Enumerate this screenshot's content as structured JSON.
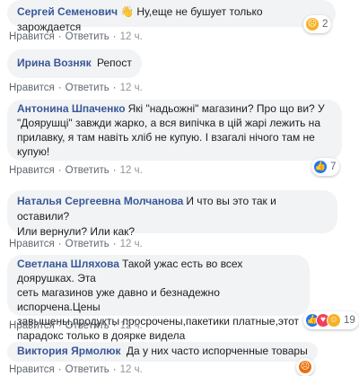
{
  "comments": [
    {
      "author": "Сергей Семенович",
      "emoji": "👋",
      "text": "Ну,еще не бушует только зарождается",
      "like_label": "Нравится",
      "reply_label": "Ответить",
      "time": "12 ч.",
      "reaction_icon": "sad-face-icon",
      "reaction_count": "2"
    },
    {
      "author": "Ирина Возняк",
      "text": "Репост",
      "like_label": "Нравится",
      "reply_label": "Ответить",
      "time": "12 ч."
    },
    {
      "author": "Антонина Шпаченко",
      "text_lines": [
        "Які \"надьожні\" магазини? Про що ви? У",
        "\"Доярушці\" завжди жарко, а вся випічка в цій жарі лежить на",
        "прилавку, я там навіть хліб не купую. І взагалі нічого там не",
        "купую!"
      ],
      "like_label": "Нравится",
      "reply_label": "Ответить",
      "time": "12 ч.",
      "reaction_icon": "like-icon",
      "reaction_count": "7"
    },
    {
      "author": "Наталья Сергеевна Молчанова",
      "text_first": "И что вы это так и оставили?",
      "text_second": "Или вернули? Или как?",
      "like_label": "Нравится",
      "reply_label": "Ответить",
      "time": "12 ч."
    },
    {
      "author": "Светлана Шляхова",
      "text_first": "Такой ужас есть во всех доярушках. Эта",
      "text_lines": [
        "сеть магазинов уже давно и безнадежно испорчена.Цены",
        "завышены,продукты просрочены,пакетики платные,этот",
        "парадокс только в доярке видела"
      ],
      "like_label": "Нравится",
      "reply_label": "Ответить",
      "time": "12 ч.",
      "reaction_icons": [
        "like-icon",
        "love-icon",
        "haha-icon"
      ],
      "reaction_count": "19"
    },
    {
      "author": "Виктория Ярмолюк",
      "text": "Да у них часто испорченные товары",
      "like_label": "Нравится",
      "reply_label": "Ответить",
      "time": "12 ч.",
      "reaction_icon": "angry-face-icon"
    }
  ],
  "colors": {
    "author": "#385898",
    "bubble": "#f2f3f5",
    "meta": "#606770",
    "like_blue": "#2078f4",
    "love_red": "#f33e58",
    "haha_yellow": "#f7b125",
    "angry_orange": "#e9710f"
  }
}
